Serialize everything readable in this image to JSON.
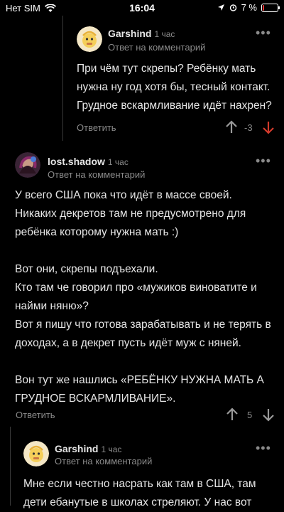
{
  "status": {
    "carrier": "Нет SIM",
    "time": "16:04",
    "battery": "7 %",
    "battery_level": 0.07
  },
  "comments": [
    {
      "author": "Garshind",
      "time": "1 час",
      "reply_note": "Ответ на комментарий",
      "body": "При чём тут скрепы? Ребёнку мать нужна ну год хотя бы, тесный контакт. Грудное вскармливание идёт нахрен?",
      "reply_label": "Ответить",
      "score": "-3"
    },
    {
      "author": "lost.shadow",
      "time": "1 час",
      "reply_note": "Ответ на комментарий",
      "body": "У всего США пока что идёт в массе своей.\nНикаких декретов там не предусмотрено для ребёнка которому нужна мать :)\n\nВот они, скрепы подъехали.\nКто там че говорил про «мужиков виноватите и найми няню»?\nВот я пишу что готова зарабатывать и не терять в доходах, а в декрет пусть идёт муж с няней.\n\nВон тут же нашлись «РЕБЁНКУ НУЖНА МАТЬ А ГРУДНОЕ ВСКАРМЛИВАНИЕ».",
      "reply_label": "Ответить",
      "score": "5"
    },
    {
      "author": "Garshind",
      "time": "1 час",
      "reply_note": "Ответ на комментарий",
      "body": "Мне если честно насрать как там в США, там дети ебанутые в школах стреляют. У нас вот"
    }
  ],
  "colors": {
    "downvote_active": "#d33a2c",
    "background": "#000000"
  }
}
